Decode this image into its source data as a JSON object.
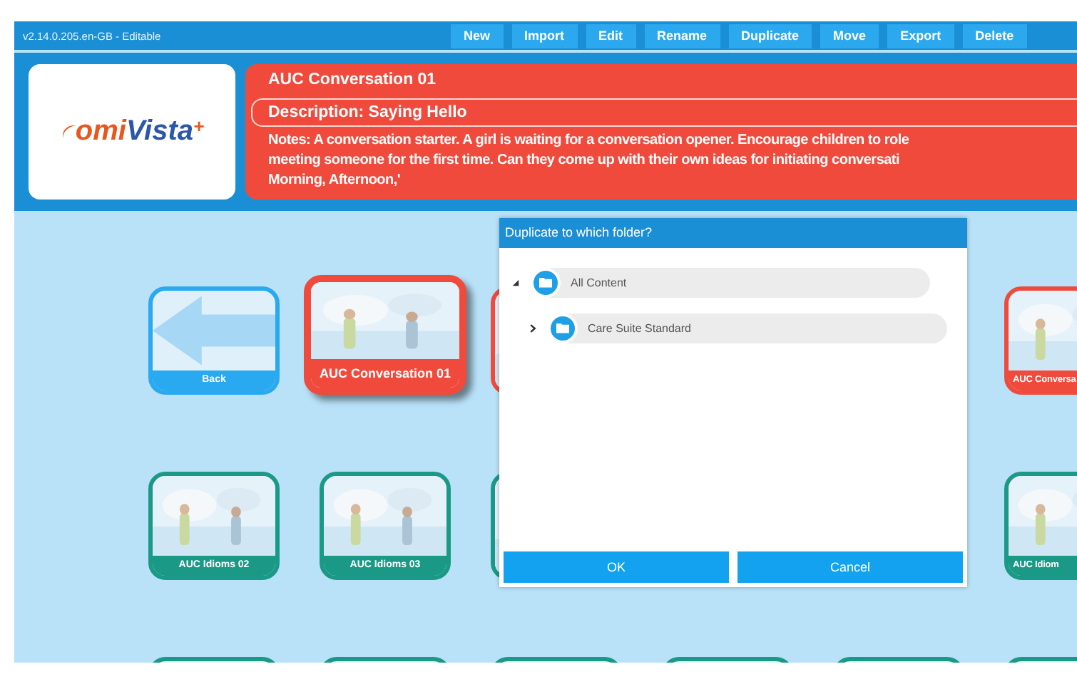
{
  "status_text": "v2.14.0.205.en-GB - Editable",
  "toolbar": [
    "New",
    "Import",
    "Edit",
    "Rename",
    "Duplicate",
    "Move",
    "Export",
    "Delete"
  ],
  "logo": {
    "text_a": "omi",
    "text_b": "Vista",
    "mark": "+"
  },
  "details": {
    "title": "AUC Conversation 01",
    "description": "Description: Saying Hello",
    "notes": [
      "Notes: A conversation starter. A girl is waiting for a conversation opener. Encourage children to role",
      "meeting someone for the first time.  Can they come up with their own ideas for initiating conversati",
      "Morning, Afternoon,'"
    ]
  },
  "tiles": [
    {
      "kind": "back",
      "label": "Back",
      "color": "#29a9ef",
      "selected": false
    },
    {
      "kind": "picture",
      "label": "AUC Conversation 01",
      "color": "#f04a3c",
      "selected": true
    },
    {
      "kind": "picture",
      "color": "#f04a3c",
      "selected": false
    },
    {
      "kind": "hidden"
    },
    {
      "kind": "hidden"
    },
    {
      "kind": "picture",
      "label": "AUC Conversa",
      "color": "#f04a3c",
      "selected": false
    },
    {
      "kind": "picture",
      "label": "AUC Idioms 02",
      "color": "#1a9a86",
      "selected": false
    },
    {
      "kind": "picture",
      "label": "AUC Idioms 03",
      "color": "#1a9a86",
      "selected": false
    },
    {
      "kind": "picture",
      "color": "#1a9a86",
      "selected": false
    },
    {
      "kind": "hidden"
    },
    {
      "kind": "hidden"
    },
    {
      "kind": "picture",
      "label": "AUC Idiom",
      "color": "#1a9a86",
      "selected": false
    },
    {
      "kind": "stub",
      "color": "#1a9a86",
      "selected": false
    },
    {
      "kind": "stub",
      "color": "#1a9a86",
      "selected": false
    },
    {
      "kind": "stub",
      "color": "#1a9a86",
      "selected": false
    },
    {
      "kind": "stub",
      "color": "#1a9a86",
      "selected": false
    },
    {
      "kind": "stub",
      "color": "#1a9a86",
      "selected": false
    },
    {
      "kind": "stub",
      "color": "#1a9a86",
      "selected": false
    }
  ],
  "dialog": {
    "title": "Duplicate to which folder?",
    "tree": [
      {
        "label": "All Content",
        "expanded": true,
        "children": [
          {
            "label": "Care Suite Standard",
            "expanded": false
          }
        ]
      }
    ],
    "buttons": [
      "OK",
      "Cancel"
    ]
  }
}
